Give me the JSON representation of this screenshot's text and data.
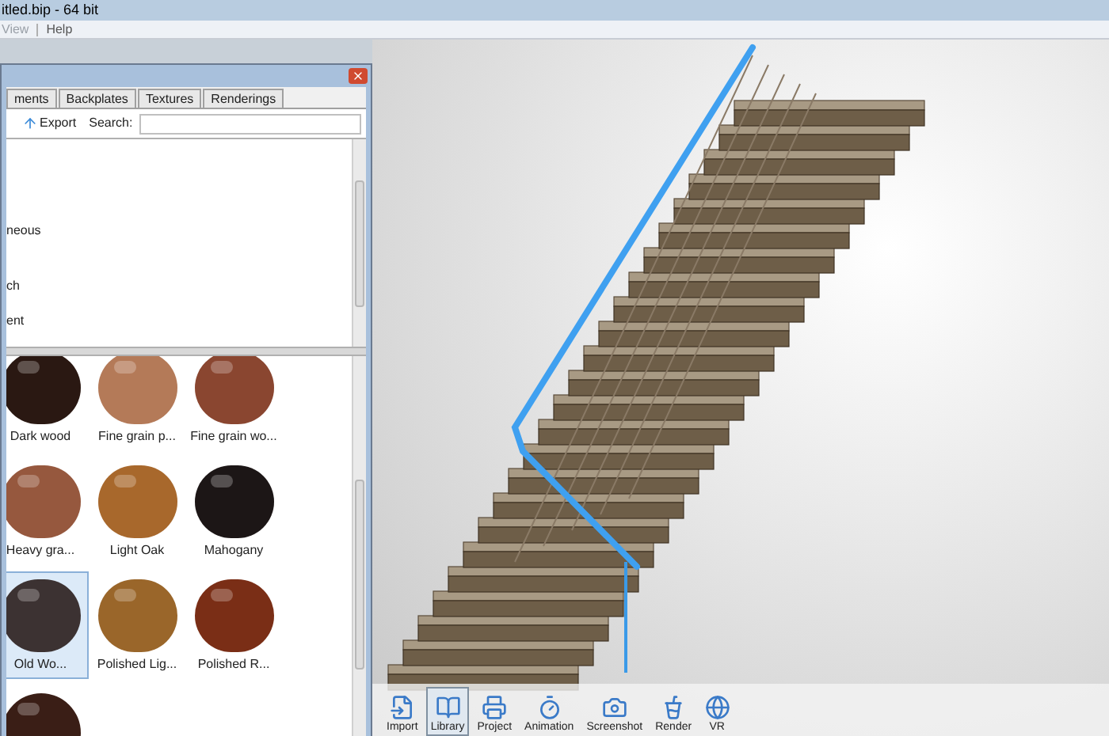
{
  "window": {
    "title": "itled.bip - 64 bit"
  },
  "menu": [
    {
      "label": "View",
      "disabled": true
    },
    {
      "label": "Help",
      "disabled": false
    }
  ],
  "panel": {
    "tabs": [
      {
        "label": "ments",
        "selected": false
      },
      {
        "label": "Backplates",
        "selected": false
      },
      {
        "label": "Textures",
        "selected": false
      },
      {
        "label": "Renderings",
        "selected": false
      }
    ],
    "export": "Export",
    "search_label": "Search:",
    "categories": [
      "neous",
      "ch",
      "ent"
    ],
    "materials": [
      {
        "label": "Dark wood",
        "color": "#2a1812",
        "selected": false
      },
      {
        "label": "Fine grain p...",
        "color": "#b47a58",
        "selected": false
      },
      {
        "label": "Fine grain wo...",
        "color": "#8a4630",
        "selected": false
      },
      {
        "label": "Heavy gra...",
        "color": "#96583e",
        "selected": false
      },
      {
        "label": "Light Oak",
        "color": "#a8682c",
        "selected": false
      },
      {
        "label": "Mahogany",
        "color": "#1c1616",
        "selected": false
      },
      {
        "label": "Old Wo...",
        "color": "#3c3232",
        "selected": true
      },
      {
        "label": "Polished Lig...",
        "color": "#9a662a",
        "selected": false
      },
      {
        "label": "Polished R...",
        "color": "#7a2e16",
        "selected": false
      },
      {
        "color": "#3a1e16",
        "selected": false
      }
    ]
  },
  "toolbar": [
    {
      "label": "Import",
      "kind": "import",
      "selected": false
    },
    {
      "label": "Library",
      "kind": "library",
      "selected": true
    },
    {
      "label": "Project",
      "kind": "project",
      "selected": false
    },
    {
      "label": "Animation",
      "kind": "animation",
      "selected": false
    },
    {
      "label": "Screenshot",
      "kind": "screenshot",
      "selected": false
    },
    {
      "label": "Render",
      "kind": "render",
      "selected": false
    },
    {
      "label": "VR",
      "kind": "vr",
      "selected": false
    }
  ]
}
